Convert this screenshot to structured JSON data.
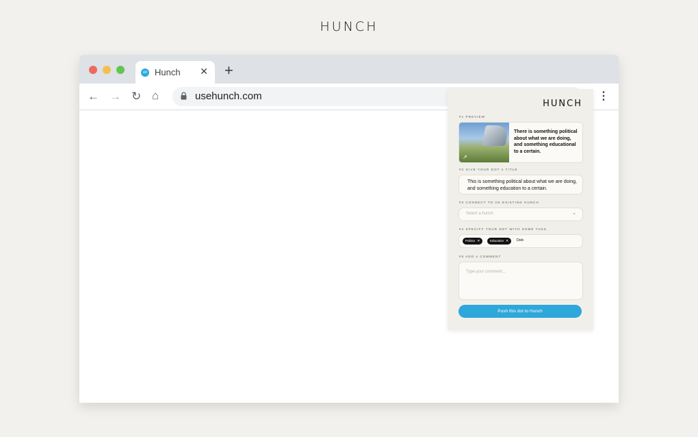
{
  "page": {
    "brand": "HUNCH"
  },
  "browser": {
    "tab": {
      "title": "Hunch",
      "favicon_text": "un"
    },
    "url": "usehunch.com",
    "colors": {
      "close": "#ed6a5e",
      "minimize": "#f4bf4f",
      "maximize": "#61c554"
    }
  },
  "extension": {
    "logo": "HUNCH",
    "preview": {
      "label": "#1  PREVIEW",
      "text": "There is something political about what we are doing, and something educational to a certain."
    },
    "title_step": {
      "label": "#2  GIVE YOUR DOT A TITLE",
      "value": "This is something political about what we are doing, and something education to a certain."
    },
    "connect_step": {
      "label": "#3  CONNECT TO AN EXISTING HUNCH",
      "placeholder": "Select a hunch"
    },
    "tags_step": {
      "label": "#4  SPECIFY YOUR DOT WITH SOME TAGS",
      "tags": [
        "Politics",
        "Education"
      ],
      "typing": "Deb"
    },
    "comment_step": {
      "label": "#5  ADD A COMMENT",
      "placeholder": "Type your comment..."
    },
    "push_button": "Push this dot to Hunch",
    "accent_color": "#2ea7da"
  }
}
